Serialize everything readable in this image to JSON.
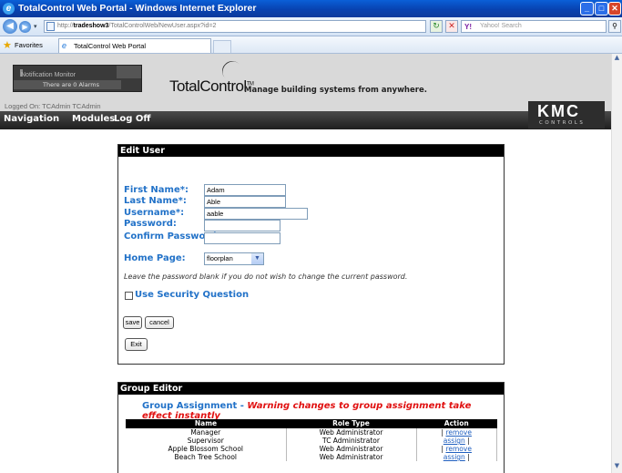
{
  "window": {
    "title": "TotalControl Web Portal - Windows Internet Explorer"
  },
  "address_bar": {
    "url_prefix": "http://",
    "url_host": "tradeshow3",
    "url_path": "/TotalControlWeb/NewUser.aspx?id=2",
    "search_placeholder": "Yahoo! Search"
  },
  "favorites_bar": {
    "favorites_label": "Favorites",
    "tab_title": "TotalControl Web Portal"
  },
  "header": {
    "notification_title": "Notification Monitor",
    "alarms_text": "There are 0 Alarms",
    "logo_text": "TotalControl",
    "logo_tm": "TM",
    "tagline": "Manage building systems from anywhere.",
    "logged_on": "Logged On: TCAdmin TCAdmin",
    "brand_mark": "KMC",
    "brand_sub": "CONTROLS"
  },
  "menu": {
    "navigation": "Navigation",
    "modules": "Modules",
    "logoff": "Log Off"
  },
  "edit_user": {
    "title": "Edit User",
    "first_name_label": "First Name*:",
    "first_name_value": "Adam",
    "last_name_label": "Last Name*:",
    "last_name_value": "Able",
    "username_label": "Username*:",
    "username_value": "aable",
    "password_label": "Password:",
    "confirm_password_label": "Confirm Password:",
    "home_page_label": "Home Page:",
    "home_page_value": "floorplan",
    "password_note": "Leave the password blank if you do not wish to change the current password.",
    "security_question_label": "Use Security Question",
    "save_label": "save",
    "cancel_label": "cancel",
    "exit_label": "Exit"
  },
  "group_editor": {
    "title": "Group Editor",
    "heading": "Group Assignment - ",
    "warning": "Warning changes to group assignment take effect instantly",
    "columns": [
      "Name",
      "Role Type",
      "Action"
    ],
    "rows": [
      {
        "name": "Manager",
        "role": "Web Administrator",
        "pre": "| ",
        "action": "remove",
        "post": ""
      },
      {
        "name": "Supervisor",
        "role": "TC Administrator",
        "pre": "",
        "action": "assign",
        "post": " |"
      },
      {
        "name": "Apple Blossom School",
        "role": "Web Administrator",
        "pre": "| ",
        "action": "remove",
        "post": ""
      },
      {
        "name": "Beach Tree School",
        "role": "Web Administrator",
        "pre": "",
        "action": "assign",
        "post": " |"
      }
    ]
  }
}
